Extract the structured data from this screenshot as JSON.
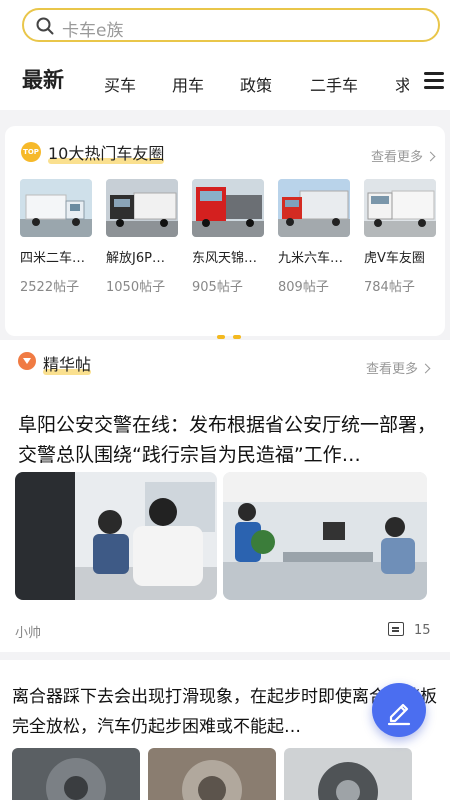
{
  "search": {
    "placeholder": "卡车e族"
  },
  "tabs": [
    {
      "label": "最新"
    },
    {
      "label": "买车"
    },
    {
      "label": "用车"
    },
    {
      "label": "政策"
    },
    {
      "label": "二手车"
    },
    {
      "label": "求"
    }
  ],
  "hot_circles": {
    "badge": "TOP",
    "title": "10大热门车友圈",
    "more": "查看更多",
    "items": [
      {
        "name": "四米二车…",
        "count": "2522帖子"
      },
      {
        "name": "解放J6P…",
        "count": "1050帖子"
      },
      {
        "name": "东风天锦…",
        "count": "905帖子"
      },
      {
        "name": "九米六车…",
        "count": "809帖子"
      },
      {
        "name": "虎V车友圈",
        "count": "784帖子"
      }
    ]
  },
  "essence": {
    "title": "精华帖",
    "more": "查看更多",
    "post": {
      "title": "阜阳公安交警在线：发布根据省公安厅统一部署，交警总队围绕“践行宗旨为民造福”工作…",
      "author": "小帅",
      "comments": "15"
    }
  },
  "post2": {
    "title": "离合器踩下去会出现打滑现象，在起步时即使离合器踏板完全放松，汽车仍起步困难或不能起…"
  },
  "colors": {
    "accent": "#f5c733",
    "fab": "#4b6ef0",
    "badge": "#f6b92a"
  }
}
